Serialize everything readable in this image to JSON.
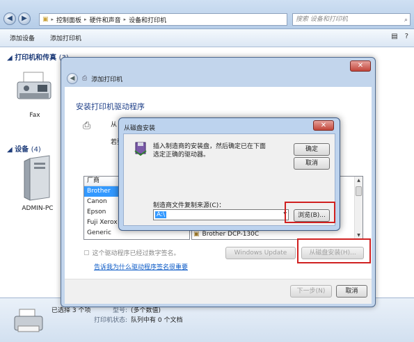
{
  "explorer": {
    "breadcrumb": [
      "控制面板",
      "硬件和声音",
      "设备和打印机"
    ],
    "search_placeholder": "搜索 设备和打印机",
    "toolbar": {
      "add_device": "添加设备",
      "add_printer": "添加打印机"
    },
    "groups": {
      "printers_title": "打印机和传真",
      "printers_count": "(3)",
      "devices_title": "设备",
      "devices_count": "(4)"
    },
    "devices": {
      "fax": "Fax",
      "admin_pc": "ADMIN-PC"
    },
    "details": {
      "selected": "已选择 3 个项",
      "model_key": "型号:",
      "model_val": "(多个数值)",
      "status_key": "打印机状态:",
      "status_val": "队列中有 0 个文档"
    }
  },
  "add_printer": {
    "title": "添加打印机",
    "close": "✕",
    "heading": "安装打印机驱动程序",
    "desc1_partial": "从",
    "desc2_partial": "若要",
    "manufacturer_header": "厂商",
    "manufacturers": [
      "Brother",
      "Canon",
      "Epson",
      "Fuji Xerox",
      "Generic"
    ],
    "selected_driver": "Brother DCP-130C",
    "signed_text": "这个驱动程序已经过数字签名。",
    "sign_link": "告诉我为什么驱动程序签名很重要",
    "windows_update": "Windows Update",
    "from_disk": "从磁盘安装(H)...",
    "next": "下一步(N)",
    "cancel": "取消"
  },
  "from_disk": {
    "title": "从磁盘安装",
    "close": "✕",
    "message": "插入制造商的安装盘，然后确定已在下面选定正确的驱动器。",
    "ok": "确定",
    "cancel": "取消",
    "copy_label": "制造商文件复制来源(C)：",
    "copy_value": "A:\\",
    "browse": "浏览(B)..."
  }
}
